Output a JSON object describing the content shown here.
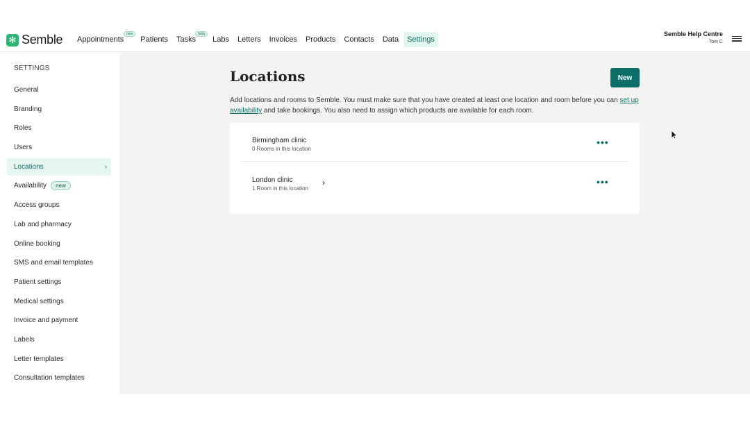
{
  "app": {
    "brand": "Semble",
    "brand_mark": "✻"
  },
  "nav": {
    "items": [
      {
        "label": "Appointments",
        "badge": "new"
      },
      {
        "label": "Patients"
      },
      {
        "label": "Tasks",
        "badge": "beta"
      },
      {
        "label": "Labs"
      },
      {
        "label": "Letters"
      },
      {
        "label": "Invoices"
      },
      {
        "label": "Products"
      },
      {
        "label": "Contacts"
      },
      {
        "label": "Data"
      },
      {
        "label": "Settings",
        "active": true
      }
    ]
  },
  "help": {
    "title": "Semble Help Centre",
    "user": "Tom C"
  },
  "sidebar": {
    "heading": "SETTINGS",
    "items": [
      {
        "label": "General"
      },
      {
        "label": "Branding"
      },
      {
        "label": "Roles"
      },
      {
        "label": "Users"
      },
      {
        "label": "Locations",
        "active": true
      },
      {
        "label": "Availability",
        "badge": "new"
      },
      {
        "label": "Access groups"
      },
      {
        "label": "Lab and pharmacy"
      },
      {
        "label": "Online booking"
      },
      {
        "label": "SMS and email templates"
      },
      {
        "label": "Patient settings"
      },
      {
        "label": "Medical settings"
      },
      {
        "label": "Invoice and payment"
      },
      {
        "label": "Labels"
      },
      {
        "label": "Letter templates"
      },
      {
        "label": "Consultation templates"
      }
    ]
  },
  "main": {
    "title": "Locations",
    "new_button": "New",
    "desc_part1": "Add locations and rooms to Semble. You must make sure that you have created at least one location and room before you can ",
    "desc_link": "set up availability",
    "desc_part2": " and take bookings. You also need to assign which products are available for each room.",
    "locations": [
      {
        "name": "Birmingham clinic",
        "sub": "0 Rooms in this location"
      },
      {
        "name": "London clinic",
        "sub": "1 Room in this location"
      }
    ],
    "more_glyph": "•••",
    "chevron_glyph": "›"
  },
  "colors": {
    "accent": "#0b6e69",
    "brand_green": "#2bb673",
    "main_bg": "#f3f3f2"
  }
}
